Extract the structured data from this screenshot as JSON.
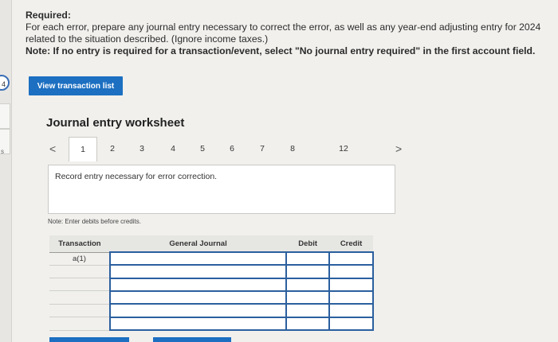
{
  "rail": {
    "badge": "4",
    "letter": "s"
  },
  "required": {
    "title": "Required:",
    "body": "For each error, prepare any journal entry necessary to correct the error, as well as any year-end adjusting entry for 2024 related to the situation described. (Ignore income taxes.)",
    "note": "Note: If no entry is required for a transaction/event, select \"No journal entry required\" in the first account field."
  },
  "view_button": "View transaction list",
  "worksheet": {
    "title": "Journal entry worksheet",
    "prev": "<",
    "next": ">",
    "tabs": [
      "1",
      "2",
      "3",
      "4",
      "5",
      "6",
      "7",
      "8",
      "12"
    ],
    "active_tab": "1",
    "entry_text": "Record entry necessary for error correction.",
    "note_debits": "Note: Enter debits before credits.",
    "table": {
      "headers": {
        "transaction": "Transaction",
        "journal": "General Journal",
        "debit": "Debit",
        "credit": "Credit"
      },
      "rows": [
        {
          "transaction": "a(1)"
        },
        {
          "transaction": ""
        },
        {
          "transaction": ""
        },
        {
          "transaction": ""
        },
        {
          "transaction": ""
        },
        {
          "transaction": ""
        }
      ]
    }
  }
}
